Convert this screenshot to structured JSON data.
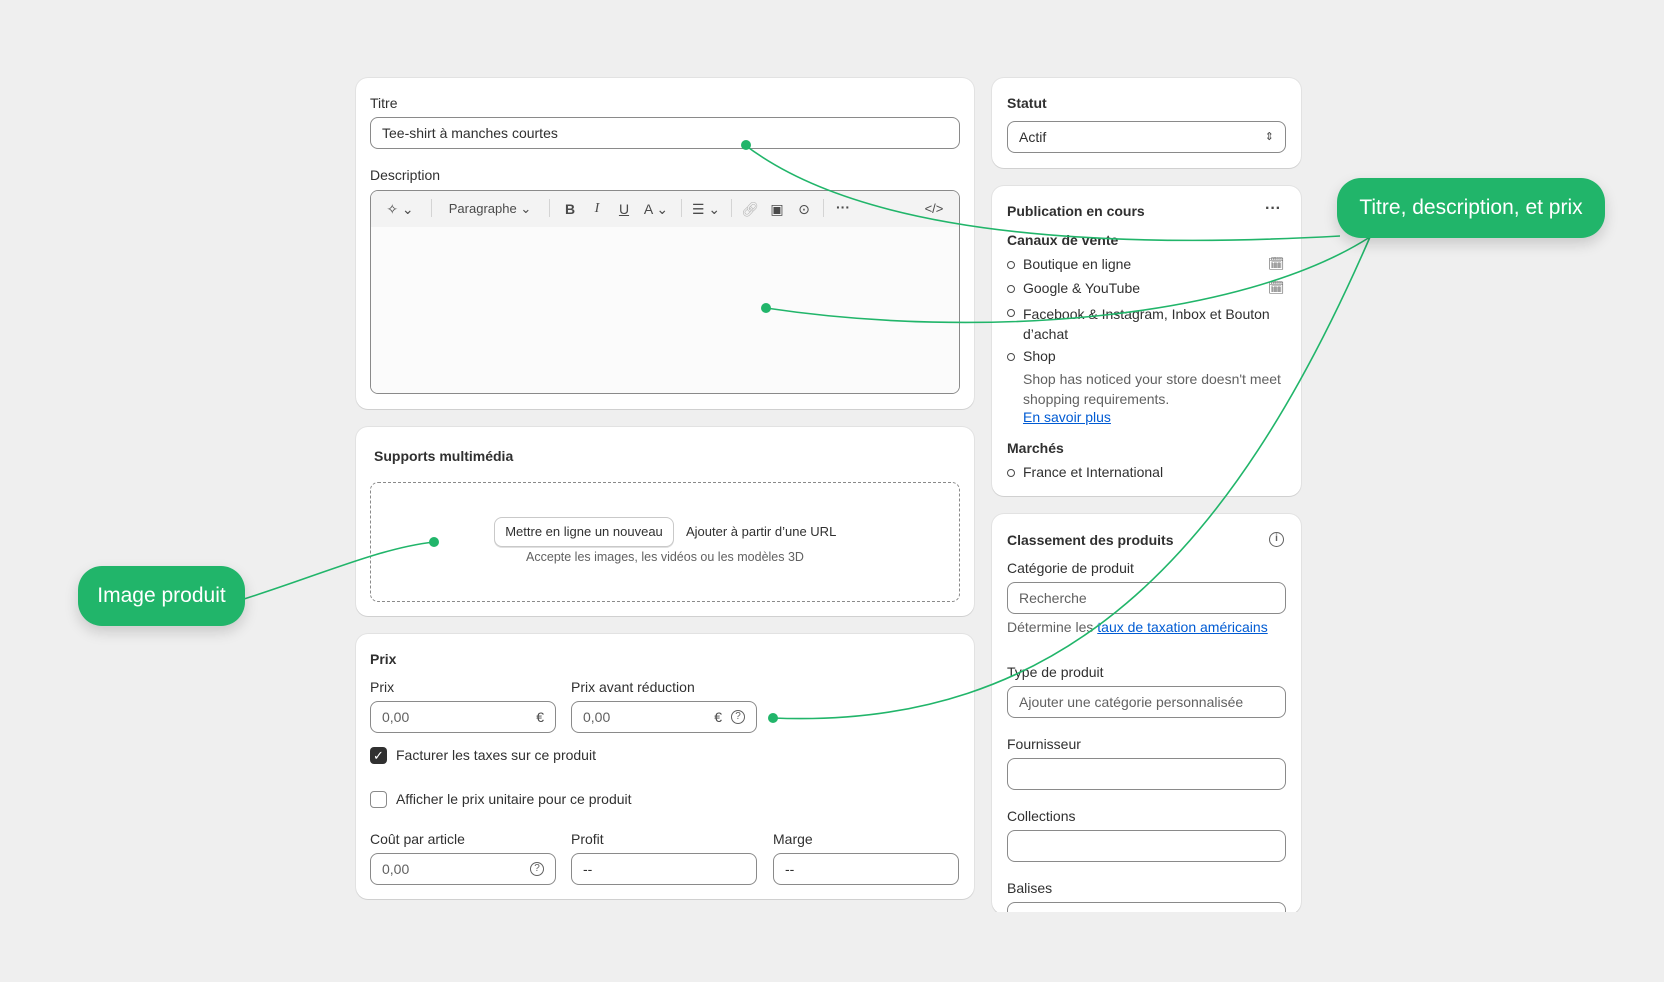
{
  "product": {
    "title_label": "Titre",
    "title_value": "Tee-shirt à manches courtes",
    "description_label": "Description",
    "toolbar": {
      "paragraph_label": "Paragraphe"
    }
  },
  "media": {
    "heading": "Supports multimédia",
    "upload_button": "Mettre en ligne un nouveau",
    "url_button": "Ajouter à partir d’une URL",
    "hint": "Accepte les images, les vidéos ou les modèles 3D"
  },
  "pricing": {
    "heading": "Prix",
    "price_label": "Prix",
    "price_value": "0,00",
    "currency": "€",
    "compare_label": "Prix avant réduction",
    "compare_value": "0,00",
    "tax_checkbox_label": "Facturer les taxes sur ce produit",
    "tax_checked": true,
    "unit_price_label": "Afficher le prix unitaire pour ce produit",
    "unit_price_checked": false,
    "cost_label": "Coût par article",
    "cost_value": "0,00",
    "profit_label": "Profit",
    "profit_value": "--",
    "margin_label": "Marge",
    "margin_value": "--"
  },
  "status": {
    "heading": "Statut",
    "value": "Actif"
  },
  "publishing": {
    "heading": "Publication en cours",
    "channels_label": "Canaux de vente",
    "channels": [
      {
        "name": "Boutique en ligne"
      },
      {
        "name": "Google & YouTube"
      },
      {
        "name": "Facebook & Instagram, Inbox et Bouton d’achat"
      },
      {
        "name": "Shop"
      }
    ],
    "shop_notice": "Shop has noticed your store doesn't meet shopping requirements.",
    "learn_more": "En savoir plus",
    "markets_label": "Marchés",
    "market": "France et International"
  },
  "organization": {
    "heading": "Classement des produits",
    "category_label": "Catégorie de produit",
    "category_placeholder": "Recherche",
    "tax_note_prefix": "Détermine les",
    "tax_note_link": "taux de taxation américains",
    "type_label": "Type de produit",
    "type_placeholder": "Ajouter une catégorie personnalisée",
    "vendor_label": "Fournisseur",
    "collections_label": "Collections",
    "tags_label": "Balises"
  },
  "callouts": {
    "image": "Image produit",
    "details": "Titre, description, et prix"
  },
  "colors": {
    "accent": "#21b56a",
    "link": "#005bd3",
    "background": "#efefef"
  }
}
